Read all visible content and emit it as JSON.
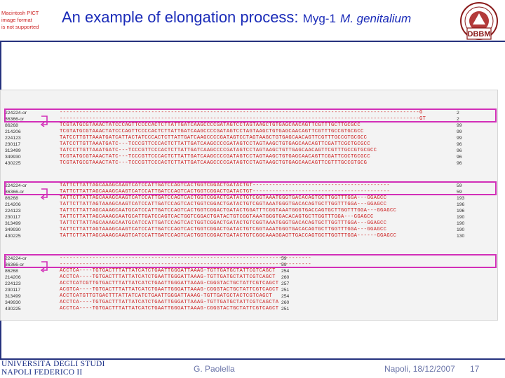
{
  "missing_image": [
    "Macintosh PICT",
    "image format",
    "is not supported"
  ],
  "title": {
    "main": "An example of elongation process:",
    "gene": "Myg-1",
    "species": "M. genitalium"
  },
  "logo_text": "DBBM",
  "footer": {
    "university_line1": "UNIVERSITÀ DEGLI STUDI",
    "university_line2": "NAPOLI FEDERICO II",
    "author": "G. Paolella",
    "place_date": "Napoli, 18/12/2007",
    "page": "17"
  },
  "alignment": {
    "blocks": [
      {
        "rows": [
          {
            "id": "224224-or",
            "seq": "--------------------------------------------------------------------------------------------------------------G",
            "end": "2"
          },
          {
            "id": "86366-or",
            "seq": "--------------------------------------------------------------------------------------------------------------GT",
            "end": "2"
          },
          {
            "id": "86268",
            "seq": "TCGTATGCGTAAACTATCCCAGTTCCCCACTCTTATTGATCAAGCCCCGATAGTCCTAGTAAGCTGTGAGCAACAGTTCGTTTGCTTGCGCC",
            "end": "99"
          },
          {
            "id": "214206",
            "seq": "TCGTATGCGTAAACTATCCCAGTTCCCCACTCTTATTGATCAAGCCCCGATAGTCCTAGTAAGCTGTGAGCAACAGTTCGTTTGCCGTGCGCC",
            "end": "99"
          },
          {
            "id": "224123",
            "seq": "TATCCTTGTTAAATGATCATTACTATCCCACTCTTATTGATCAAGCCCCGATAGTCCTAGTAAGCTGTGAGCAACAGTTCGTTTGCCGTGCGCC",
            "end": "99"
          },
          {
            "id": "230117",
            "seq": "TATCCTTGTTAAATGATC---TCCCGTTCCCACTCTTATTGATCAAGCCCCGATAGTCCTAGTAAGCTGTGAGCAACAGTTCGATTCGCTGCGCC",
            "end": "96"
          },
          {
            "id": "313499",
            "seq": "TATCCTTGTTAAATGATC---TCCCGTTCCCACTCTTATTGATCAAGCCCCGATAGTCCTAGTAAGCTGTTGAGCAACAGTTCGTTTGCCGTGCGCC",
            "end": "96"
          },
          {
            "id": "349930",
            "seq": "TCGTATGCGTAAACTATC---TCCCGTTCCCACTCTTATTGATCAAGCCCCGATAGTCCTAGTAAGCTGTGAGCAACAGTTCGATTCGCTGCGCC",
            "end": "96"
          },
          {
            "id": "430225",
            "seq": "TCGTATGCGTAAACTATC---TCCCGTTCCCACTCTTATTGATCAAGCCCCGATAGTCCTAGTAAGCTGTGAGCAACAGTTCGTTTGCCGTGCG",
            "end": "96"
          }
        ]
      },
      {
        "rows": [
          {
            "id": "224224-or",
            "seq": "TATTCTTATTAGCAAAGCAAGTCATCCATTGATCCAGTCACTGGTCGGACTGATACTGT------------------------------------------",
            "end": "59"
          },
          {
            "id": "86366-or",
            "seq": "TATTCTTATTAGCAAAGCAAGTCATCCATTGATCCAGTCACTGGTCGGACTGATACTGT------------------------------------------",
            "end": "59"
          },
          {
            "id": "86268",
            "seq": "TATTCTTATTAGCAAAGCAAGTCATCCATTGATCCAGTCACTGGTCGGACTGATACTGTCGGTAAATGGGTGACACAGTGCTTGGTTTGGA---GGAGCC",
            "end": "193"
          },
          {
            "id": "214206",
            "seq": "TATTCTTATTAGTAAAGCAAGTCATCCATTGATCCAGTCACTGGTCGGACTGATACTGTCGGTAAATGGGTGACACAGTGCTTGGTTTGGA---GGAGCC",
            "end": "196"
          },
          {
            "id": "224123",
            "seq": "TATTCTTATTAGCAAAGCAATGCATCCATTGATCCAGTCACTGGTCGGACTGATACTGGATTTCGGTAAATGGGTGACCAGTGCTTGGTTTGGA---GGAGCC",
            "end": "196"
          },
          {
            "id": "230117",
            "seq": "TATTCTTATTAGCAAAGCAATGCATTGATCCAGTCACTGGTCGGACTGATACTGTCGGTAAATGGGTGACACAGTGCTTGGTTTGGA---GGAGCC",
            "end": "190"
          },
          {
            "id": "313499",
            "seq": "TATTCTTATTAGCAAAGCAATGCATCCATTGATCCAGTCACTGGTCGGACTGATACTGTCGGTAAATGGGTGACACAGTGCTTGGTTTGGA---GGAGCC",
            "end": "190"
          },
          {
            "id": "349930",
            "seq": "TATTCTTATTAGTAAAGCAAGTCATCCATTGATCCAGTCACTGGTCGGACTGATACTGTCGGTAAATGGGTGACACAGTGCTTGGTTTGGA---GGAGCC",
            "end": "190"
          },
          {
            "id": "430225",
            "seq": "TATTCTTATTAGCAAAGCAAGTCATCCATTGATCCAGTCACTGGTCGGACTGATACTGTCGGCAAAGGAGTTGACCAGTGCTTGGTTTGGA------GGAGCC",
            "end": "130"
          }
        ]
      },
      {
        "rows": [
          {
            "id": "224224-or",
            "seq": "-----------------------------------------------------------------------------",
            "end": "59"
          },
          {
            "id": "86366-or",
            "seq": "-----------------------------------------------------------------------------",
            "end": "59"
          },
          {
            "id": "86268",
            "seq": "ACCTCA----TGTGACTTTATTATCATCTGAATTGGGATTAAAG-TGTTGATGCTATTCGTCAGCT",
            "end": "254"
          },
          {
            "id": "214206",
            "seq": "ACCTCA----TGTGACTTTATTATCATCTGAATTGGGATTAAAG-TGTTGATGCTATTCGTCAGCT",
            "end": "260"
          },
          {
            "id": "224123",
            "seq": "ACCTCATCGTTGTGACTTTATTATCATCTGAATTGGGATTAAAG-CGGGTACTGCTATTCGTCAGCT",
            "end": "257"
          },
          {
            "id": "230117",
            "seq": "ACGTCA----TGTGACTTTATTATCATCTGAATTGGGATTAAAG-CGGGTACTGCTATTCGTCAGCT",
            "end": "251"
          },
          {
            "id": "313499",
            "seq": "ACCTCATGTTGTGACTTTATTATCATCTGAATTGGGATTAAAG-TGTTGATGCTACTCGTCAGCT",
            "end": "254"
          },
          {
            "id": "349930",
            "seq": "ACCTCA----TGTGACTTTATTATCATCTGAATTGGGATTAAAG-TGTTGATGCTATTCGTCAGCTA",
            "end": "260"
          },
          {
            "id": "430225",
            "seq": "ACCTCA----TGTGACTTTATTATCATCTGAATTGGGATTAAAG-CGGGTACTGCTATTCGTCAGCT",
            "end": "251"
          }
        ]
      }
    ]
  },
  "colors": {
    "title": "#1a2bb8",
    "sequence": "#cc1a1a",
    "highlight": "#d22fb8",
    "rule": "#26327e"
  }
}
